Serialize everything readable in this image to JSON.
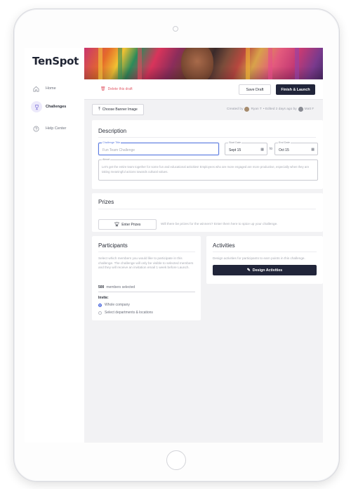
{
  "brand": {
    "logo": "TenSpot"
  },
  "sidebar": {
    "items": [
      {
        "label": "Home",
        "icon": "home-icon"
      },
      {
        "label": "Challenges",
        "icon": "trophy-icon",
        "active": true
      },
      {
        "label": "Help Center",
        "icon": "help-icon"
      }
    ]
  },
  "toolbar": {
    "delete_label": "Delete this draft",
    "save_label": "Save Draft",
    "finish_label": "Finish & Launch"
  },
  "banner": {
    "choose_label": "Choose Banner Image"
  },
  "meta": {
    "created_by_label": "Created by",
    "creator": "Ryan T",
    "edited_text": "• Edited 2 days ago by",
    "editor": "Matt F"
  },
  "description": {
    "title": "Description",
    "challenge_title_label": "Challenge Title",
    "challenge_title_placeholder": "Fun Team Challenge",
    "start_label": "Start Date",
    "start_value": "Sept 15",
    "to_label": "to",
    "end_label": "End Date",
    "end_value": "Oct 15",
    "about_label": "About",
    "about_text": "Let's get the entire team together for some fun and educational activities! Employees who are more engaged are more productive, especially when they are taking meaningful actions towards cultural values."
  },
  "prizes": {
    "title": "Prizes",
    "button_label": "Enter Prizes",
    "hint": "Will there be prizes for the winners? Enter them here to spice up your challenge."
  },
  "participants": {
    "title": "Participants",
    "description": "Select which members you would like to participate in this challenge. The challenge will only be visible to selected members and they will receive an invitation email 1 week before Launch.",
    "members_count": "500",
    "members_label": "members selected",
    "invite_label": "Invite:",
    "options": [
      {
        "label": "Whole company",
        "selected": true
      },
      {
        "label": "Select departments & locations",
        "selected": false
      }
    ]
  },
  "activities": {
    "title": "Activities",
    "description": "Design activities for participants to earn points in this challenge.",
    "button_label": "Design Activities"
  },
  "colors": {
    "accent": "#21253a",
    "link_danger": "#e25d6a",
    "focus": "#5b7be0",
    "active_nav_bg": "#ece9fb"
  }
}
